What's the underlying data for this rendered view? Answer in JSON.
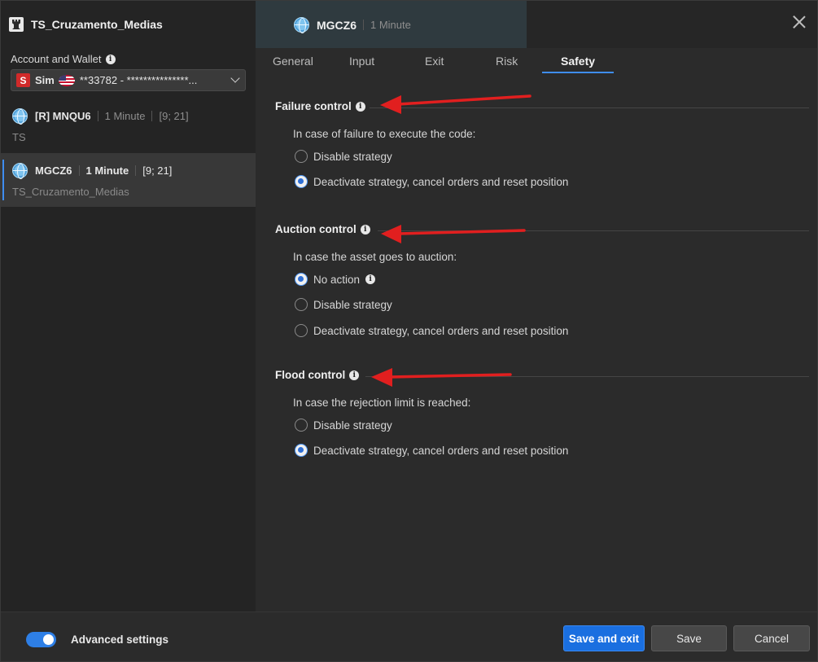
{
  "app": {
    "title": "TS_Cruzamento_Medias"
  },
  "account": {
    "label": "Account and Wallet",
    "badge": "S",
    "mode": "Sim",
    "number": "**33782 - ***************..."
  },
  "strategies": [
    {
      "symbol": "[R] MNQU6",
      "timeframe": "1 Minute",
      "params": "[9; 21]",
      "name": "TS"
    },
    {
      "symbol": "MGCZ6",
      "timeframe": "1 Minute",
      "params": "[9; 21]",
      "name": "TS_Cruzamento_Medias"
    }
  ],
  "header": {
    "symbol": "MGCZ6",
    "timeframe": "1 Minute"
  },
  "tabs": [
    "General",
    "Input",
    "Exit",
    "Risk",
    "Safety"
  ],
  "active_tab": "Safety",
  "sections": {
    "failure": {
      "title": "Failure control",
      "desc": "In case of failure to execute the code:",
      "options": [
        "Disable strategy",
        "Deactivate strategy, cancel orders and reset position"
      ],
      "selected": 1
    },
    "auction": {
      "title": "Auction control",
      "desc": "In case the asset goes to auction:",
      "options": [
        "No action",
        "Disable strategy",
        "Deactivate strategy, cancel orders and reset position"
      ],
      "selected": 0
    },
    "flood": {
      "title": "Flood control",
      "desc": "In case the rejection limit is reached:",
      "options": [
        "Disable strategy",
        "Deactivate strategy, cancel orders and reset position"
      ],
      "selected": 1
    }
  },
  "footer": {
    "advanced_label": "Advanced settings",
    "advanced_on": true,
    "save_exit": "Save and exit",
    "save": "Save",
    "cancel": "Cancel"
  },
  "colors": {
    "accent": "#2e7fe6",
    "annotation_arrow": "#e11f1f"
  }
}
